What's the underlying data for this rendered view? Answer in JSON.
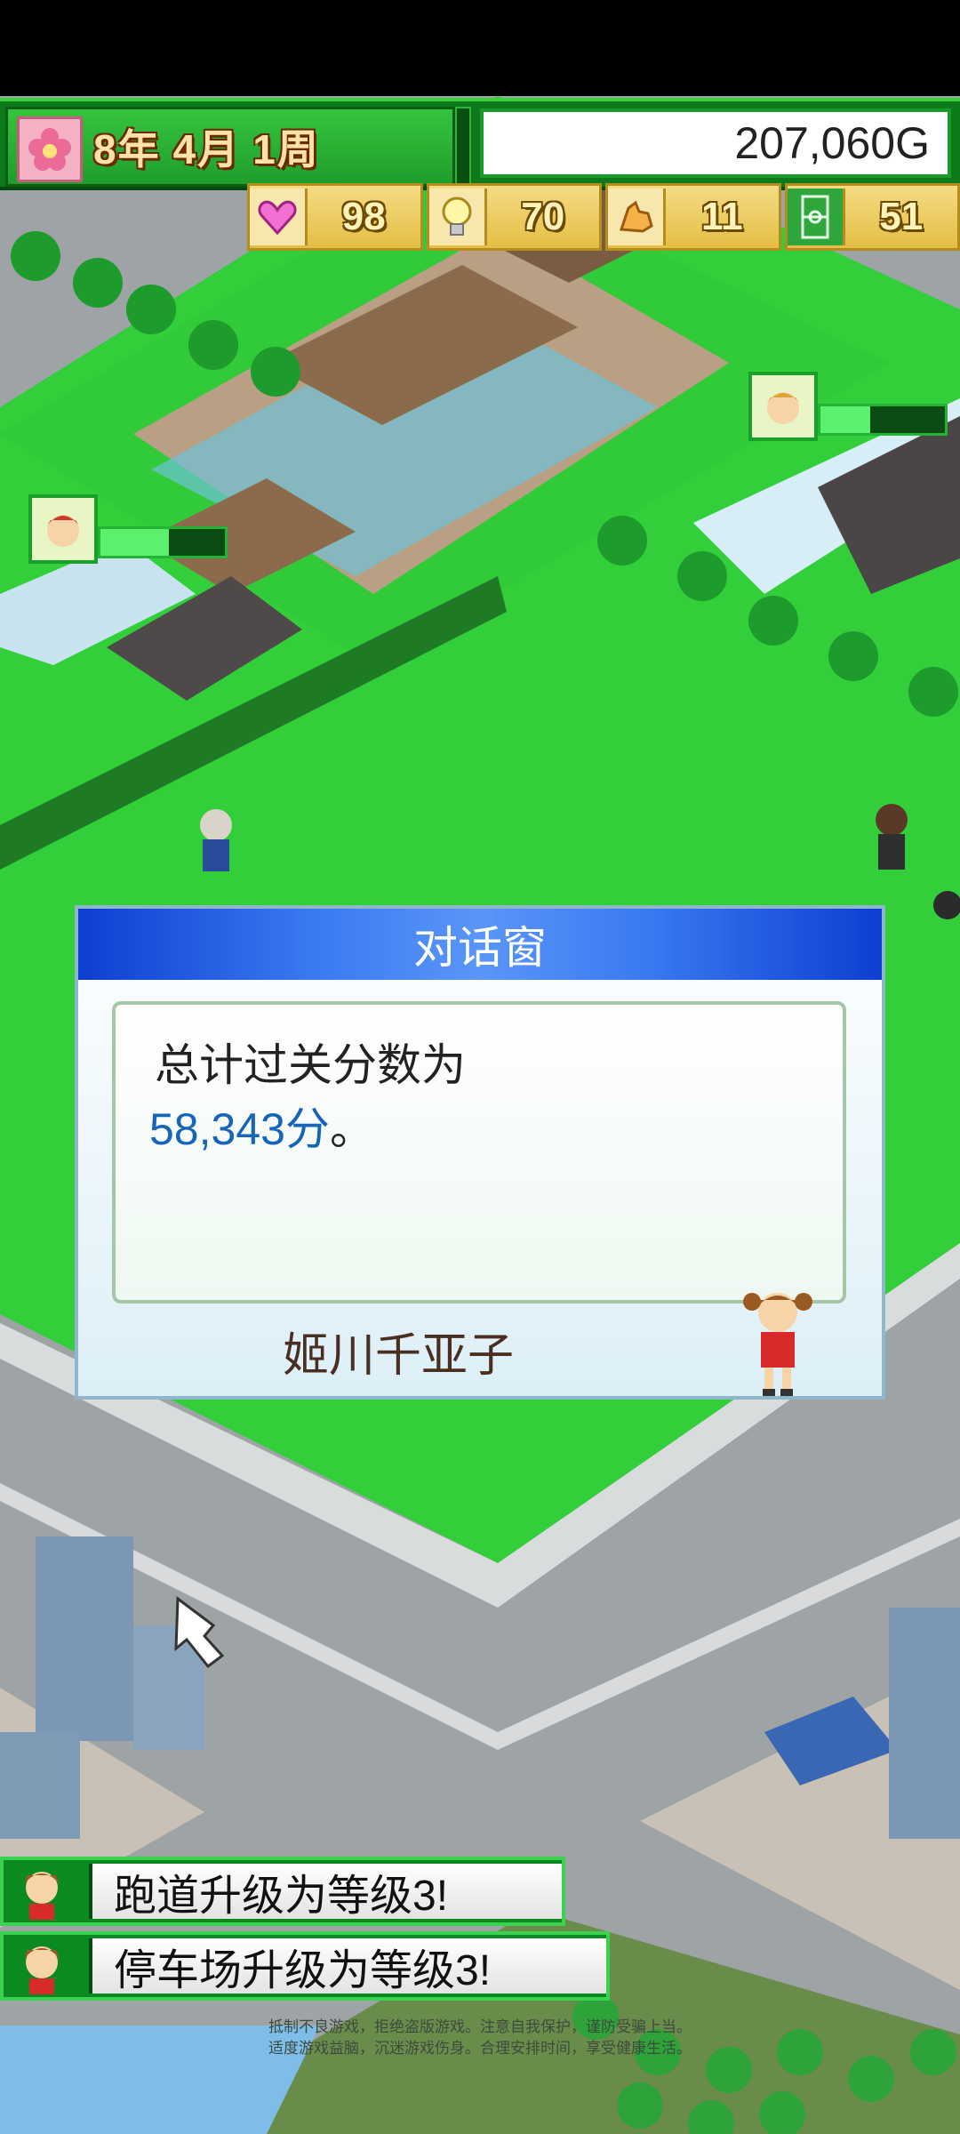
{
  "hud": {
    "date": {
      "year": "8年",
      "month": "4月",
      "week": "1周"
    },
    "money": "207,060G"
  },
  "stats": [
    {
      "icon": "heart-icon",
      "value": "98"
    },
    {
      "icon": "lightbulb-icon",
      "value": "70"
    },
    {
      "icon": "muscle-icon",
      "value": "11"
    },
    {
      "icon": "field-icon",
      "value": "51"
    }
  ],
  "characters": [
    {
      "icon": "blond-boy-avatar",
      "level": 0.4
    },
    {
      "icon": "red-hair-boy-avatar",
      "level": 0.55
    }
  ],
  "dialog": {
    "title": "对话窗",
    "line1": "总计过关分数为",
    "score": "58,343分",
    "score_suffix": "。",
    "speaker": "姬川千亚子"
  },
  "notifications": [
    {
      "text": "跑道升级为等级3!"
    },
    {
      "text": "停车场升级为等级3!"
    }
  ],
  "disclaimer": {
    "line1": "抵制不良游戏，拒绝盗版游戏。注意自我保护，谨防受骗上当。",
    "line2": "适度游戏益脑，沉迷游戏伤身。合理安排时间，享受健康生活。"
  },
  "colors": {
    "hud_green": "#0c7a1b",
    "dialog_title_blue": "#0d3fd0",
    "score_blue": "#1665b8",
    "grass": "#35d13c"
  }
}
